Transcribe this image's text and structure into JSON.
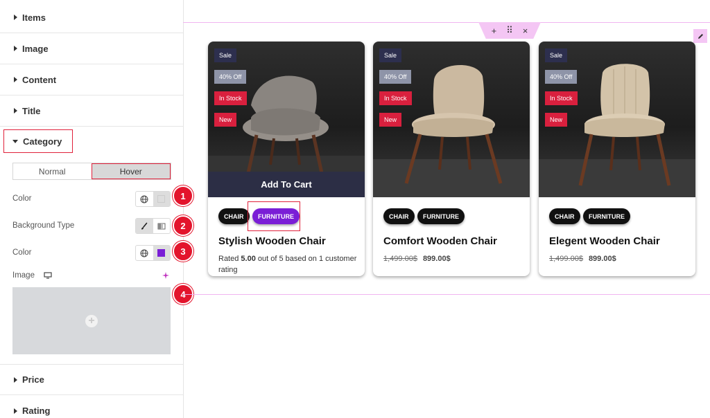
{
  "panel": {
    "sections_top": [
      "Items",
      "Image",
      "Content",
      "Title"
    ],
    "category_label": "Category",
    "tabs": [
      "Normal",
      "Hover"
    ],
    "active_tab": "Hover",
    "controls": {
      "color1_label": "Color",
      "bg_type_label": "Background Type",
      "color2_label": "Color",
      "image_label": "Image"
    },
    "swatch_colors": {
      "color1": "#ffffff",
      "color2": "#7a1ed6"
    },
    "markers": [
      "1",
      "2",
      "3",
      "4"
    ],
    "sections_bottom": [
      "Price",
      "Rating"
    ]
  },
  "canvas": {
    "toolbar": {
      "add": "+",
      "drag": "⠿",
      "close": "×"
    },
    "badges": {
      "sale": "Sale",
      "off": "40% Off",
      "stock": "In Stock",
      "new": "New"
    },
    "cart_label": "Add To Cart",
    "chips": {
      "chair": "CHAIR",
      "furniture": "FURNITURE"
    },
    "cards": [
      {
        "title": "Stylish Wooden Chair",
        "rating_pre": "Rated ",
        "rating_value": "5.00",
        "rating_post": " out of 5 based on 1 customer rating"
      },
      {
        "title": "Comfort Wooden Chair",
        "old_price": "1,499.00$",
        "price": "899.00$"
      },
      {
        "title": "Elegent Wooden Chair",
        "old_price": "1,499.00$",
        "price": "899.00$"
      }
    ]
  }
}
